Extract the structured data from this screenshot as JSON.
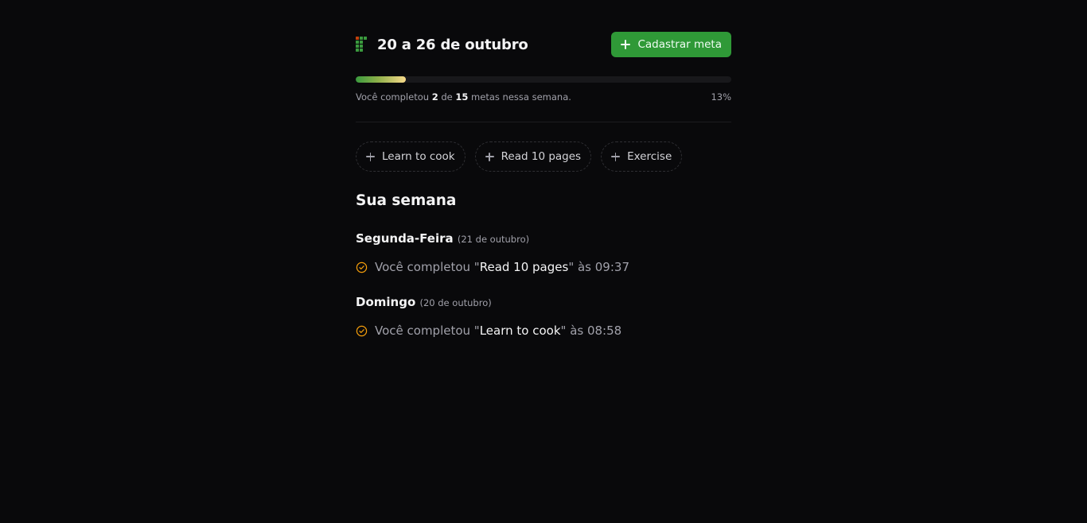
{
  "header": {
    "title": "20 a 26 de outubro",
    "register_button_label": "Cadastrar meta"
  },
  "progress": {
    "completed": "2",
    "total": "15",
    "percent_label": "13%",
    "fraction": 0.133,
    "text_before": "Você completou ",
    "text_middle": " de ",
    "text_after": " metas nessa semana."
  },
  "pending_goals": [
    {
      "label": "Learn to cook"
    },
    {
      "label": "Read 10 pages"
    },
    {
      "label": "Exercise"
    }
  ],
  "week": {
    "title": "Sua semana",
    "days": [
      {
        "name": "Segunda-Feira",
        "date": "(21 de outubro)",
        "entries": [
          {
            "prefix": "Você completou \"",
            "goal": "Read 10 pages",
            "suffix": "\" às 09:37"
          }
        ]
      },
      {
        "name": "Domingo",
        "date": "(20 de outubro)",
        "entries": [
          {
            "prefix": "Você completou \"",
            "goal": "Learn to cook",
            "suffix": "\" às 08:58"
          }
        ]
      }
    ]
  },
  "colors": {
    "accent": "#2f9937",
    "check": "#f59e0b",
    "background": "#09090b"
  },
  "icons": {
    "logo": "grid-logo-icon",
    "add": "plus-icon",
    "completed": "check-circle-icon"
  }
}
